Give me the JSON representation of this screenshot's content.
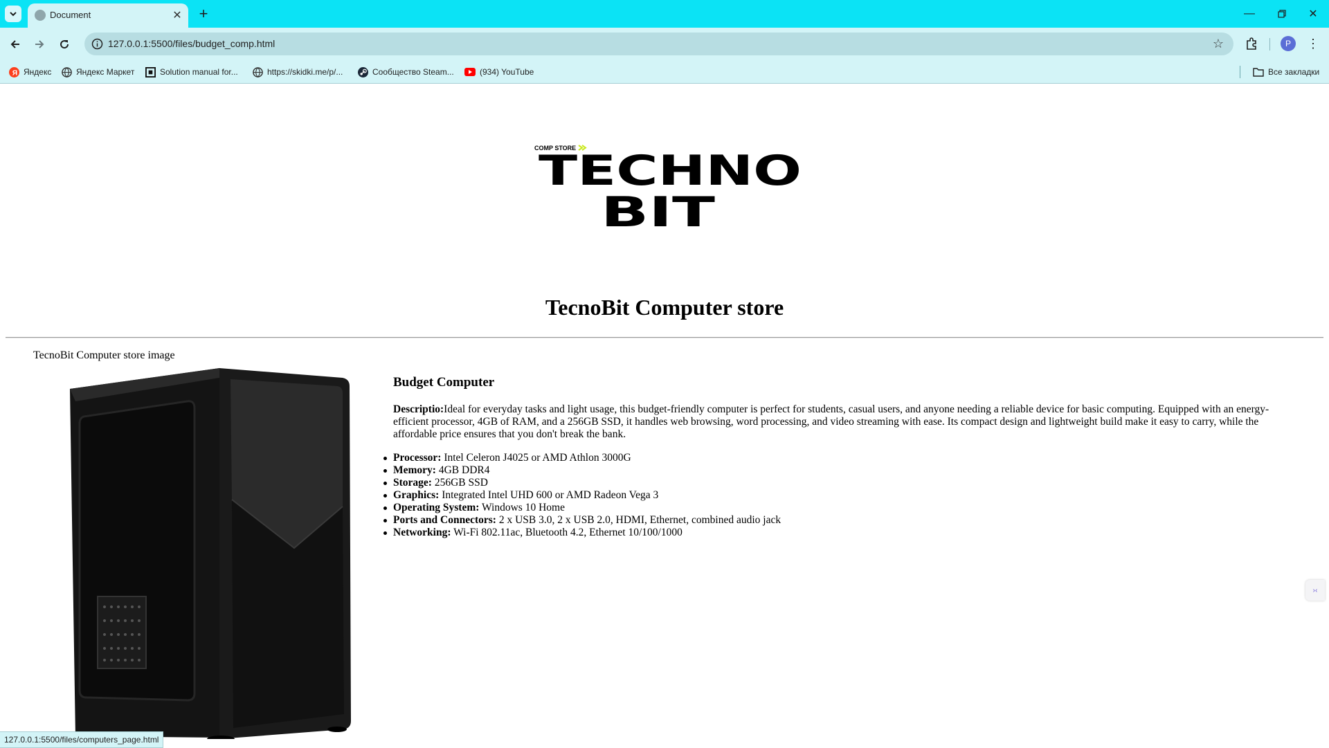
{
  "browser": {
    "tab_title": "Document",
    "url": "127.0.0.1:5500/files/budget_comp.html",
    "profile_initial": "P",
    "status_url": "127.0.0.1:5500/files/computers_page.html",
    "bookmarks": [
      {
        "label": "Яндекс",
        "icon": "yandex-icon",
        "color": "#fc3f1d"
      },
      {
        "label": "Яндекс Маркет",
        "icon": "globe-icon",
        "color": "#333333"
      },
      {
        "label": "Solution manual for...",
        "icon": "site-icon",
        "color": "#111111"
      },
      {
        "label": "https://skidki.me/p/...",
        "icon": "globe-icon",
        "color": "#333333"
      },
      {
        "label": "Сообщество Steam...",
        "icon": "steam-icon",
        "color": "#1b2838"
      },
      {
        "label": "(934) YouTube",
        "icon": "youtube-icon",
        "color": "#ff0000"
      }
    ],
    "all_bookmarks_label": "Все закладки"
  },
  "colors": {
    "chrome_accent": "#0be3f5",
    "chrome_panel": "#d3f4f7",
    "omnibox": "#b7dde2",
    "profile": "#5b6ed6"
  },
  "page": {
    "logo": {
      "small_text": "COMP STORE",
      "line1": "TECHNO",
      "line2": "BIT",
      "accent": "#c9e81e"
    },
    "title": "TecnoBit Computer store",
    "image_alt": "TecnoBit Computer store image",
    "product": {
      "name": "Budget Computer",
      "description_label": "Descriptio:",
      "description_text": "Ideal for everyday tasks and light usage, this budget-friendly computer is perfect for students, casual users, and anyone needing a reliable device for basic computing. Equipped with an energy-efficient processor, 4GB of RAM, and a 256GB SSD, it handles web browsing, word processing, and video streaming with ease. Its compact design and lightweight build make it easy to carry, while the affordable price ensures that you don't break the bank.",
      "specs": [
        {
          "label": "Processor:",
          "value": "Intel Celeron J4025 or AMD Athlon 3000G"
        },
        {
          "label": "Memory:",
          "value": "4GB DDR4"
        },
        {
          "label": "Storage:",
          "value": "256GB SSD"
        },
        {
          "label": "Graphics:",
          "value": "Integrated Intel UHD 600 or AMD Radeon Vega 3"
        },
        {
          "label": "Operating System:",
          "value": "Windows 10 Home"
        },
        {
          "label": "Ports and Connectors:",
          "value": "2 x USB 3.0, 2 x USB 2.0, HDMI, Ethernet, combined audio jack"
        },
        {
          "label": "Networking:",
          "value": "Wi-Fi 802.11ac, Bluetooth 4.2, Ethernet 10/100/1000"
        }
      ]
    }
  }
}
